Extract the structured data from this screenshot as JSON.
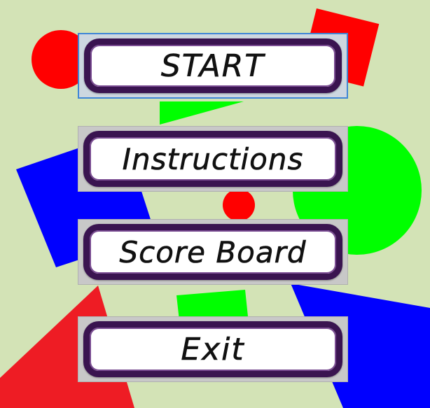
{
  "menu": {
    "start_label": "START",
    "instructions_label": "Instructions",
    "scoreboard_label": "Score Board",
    "exit_label": "Exit"
  },
  "colors": {
    "background": "#d3e3b6",
    "red": "#ff0000",
    "green": "#00ff00",
    "blue": "#0000ff",
    "button_border": "#3a1450",
    "focus_outline": "#3f86d6"
  }
}
